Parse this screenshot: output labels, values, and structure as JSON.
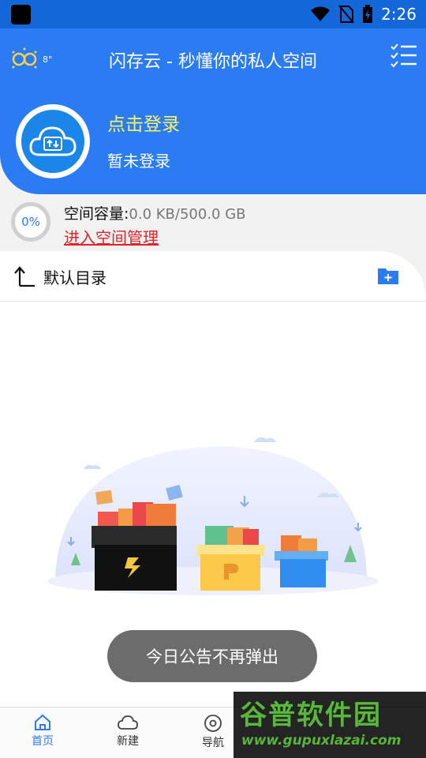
{
  "status_bar": {
    "time": "2:26",
    "icons": [
      "wifi-icon",
      "no-sim-icon",
      "battery-charging-icon"
    ]
  },
  "header": {
    "weather_temp": "8°",
    "title": "闪存云 - 秒懂你的私人空间",
    "menu_icon": "checklist-icon"
  },
  "account": {
    "login_link": "点击登录",
    "status": "暂未登录"
  },
  "storage": {
    "percent": "0%",
    "label": "空间容量:",
    "value": "0.0 KB/500.0 GB",
    "manage_link": "进入空间管理"
  },
  "directory": {
    "label": "默认目录"
  },
  "toast": {
    "text": "今日公告不再弹出"
  },
  "bottom_nav": {
    "items": [
      {
        "label": "首页",
        "icon": "home-icon",
        "active": true
      },
      {
        "label": "新建",
        "icon": "cloud-icon",
        "active": false
      },
      {
        "label": "导航",
        "icon": "compass-icon",
        "active": false
      }
    ]
  },
  "watermark": {
    "title": "谷普软件园",
    "url": "www.gupuxlazai.com"
  },
  "colors": {
    "primary": "#2b7bf3",
    "status_bar": "#1467d9",
    "login_link": "#f8f36a",
    "manage_link": "#e0242a",
    "toast_bg": "#6c6c6c"
  }
}
